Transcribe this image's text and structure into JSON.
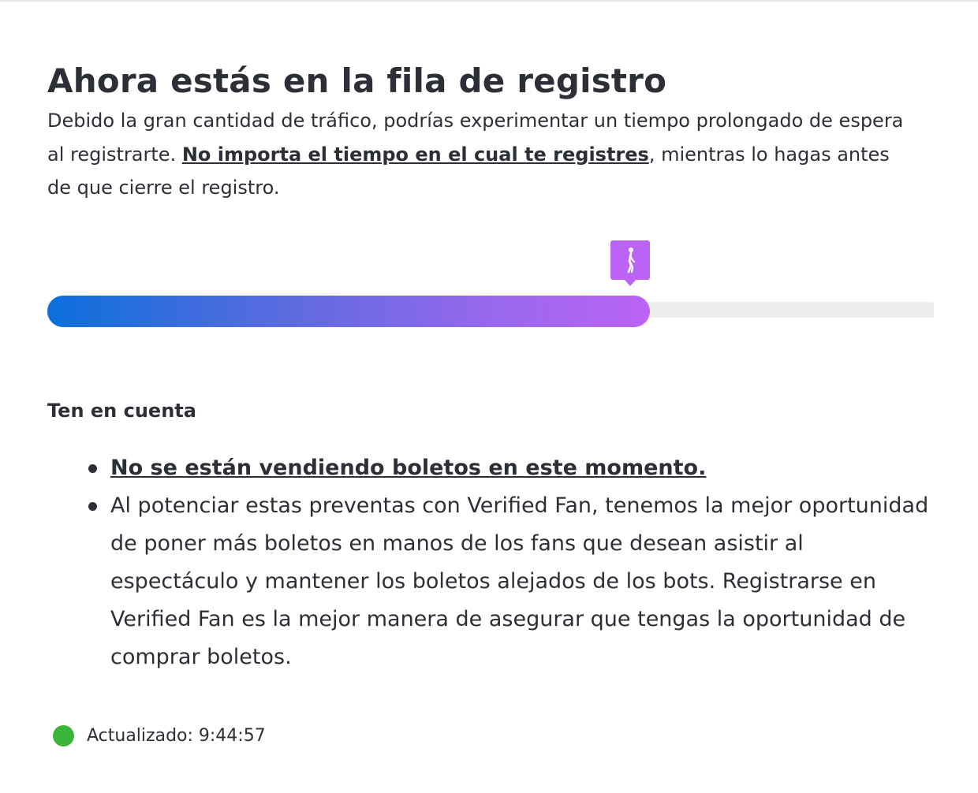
{
  "header": {
    "title": "Ahora estás en la fila de registro"
  },
  "intro": {
    "text_before": "Debido la gran cantidad de tráfico, podrías experimentar un tiempo prolongado de espera al registrarte. ",
    "link_text": "No importa el tiempo en el cual te registres",
    "text_after": ", mientras lo hagas antes de que cierre el registro."
  },
  "queue": {
    "progress_fraction": 0.68,
    "marker_icon": "walking-person-icon",
    "colors": {
      "start": "#0b6fdc",
      "end": "#bb63f5",
      "track": "#eeeeee"
    }
  },
  "notes": {
    "heading": "Ten en cuenta",
    "items": [
      {
        "text": "No se están vendiendo boletos en este momento.",
        "is_link": true
      },
      {
        "text": "Al potenciar estas preventas con Verified Fan, tenemos la mejor oportunidad de poner más boletos en manos de los fans que desean asistir al espectáculo y mantener los boletos alejados de los bots. Registrarse en Verified Fan es la mejor manera de asegurar que tengas la oportunidad de comprar boletos.",
        "is_link": false
      }
    ]
  },
  "status": {
    "label": "Actualizado: 9:44:57",
    "indicator_color": "#3bb43a"
  }
}
